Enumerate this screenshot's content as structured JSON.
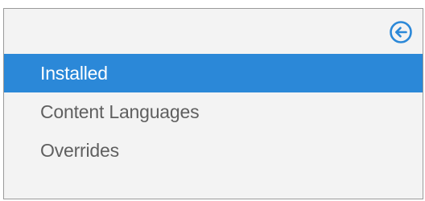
{
  "header": {
    "back_icon": "back-arrow-circle-icon",
    "accent_color": "#2b88d8"
  },
  "menu": {
    "items": [
      {
        "label": "Installed",
        "selected": true
      },
      {
        "label": "Content Languages",
        "selected": false
      },
      {
        "label": "Overrides",
        "selected": false
      }
    ]
  }
}
